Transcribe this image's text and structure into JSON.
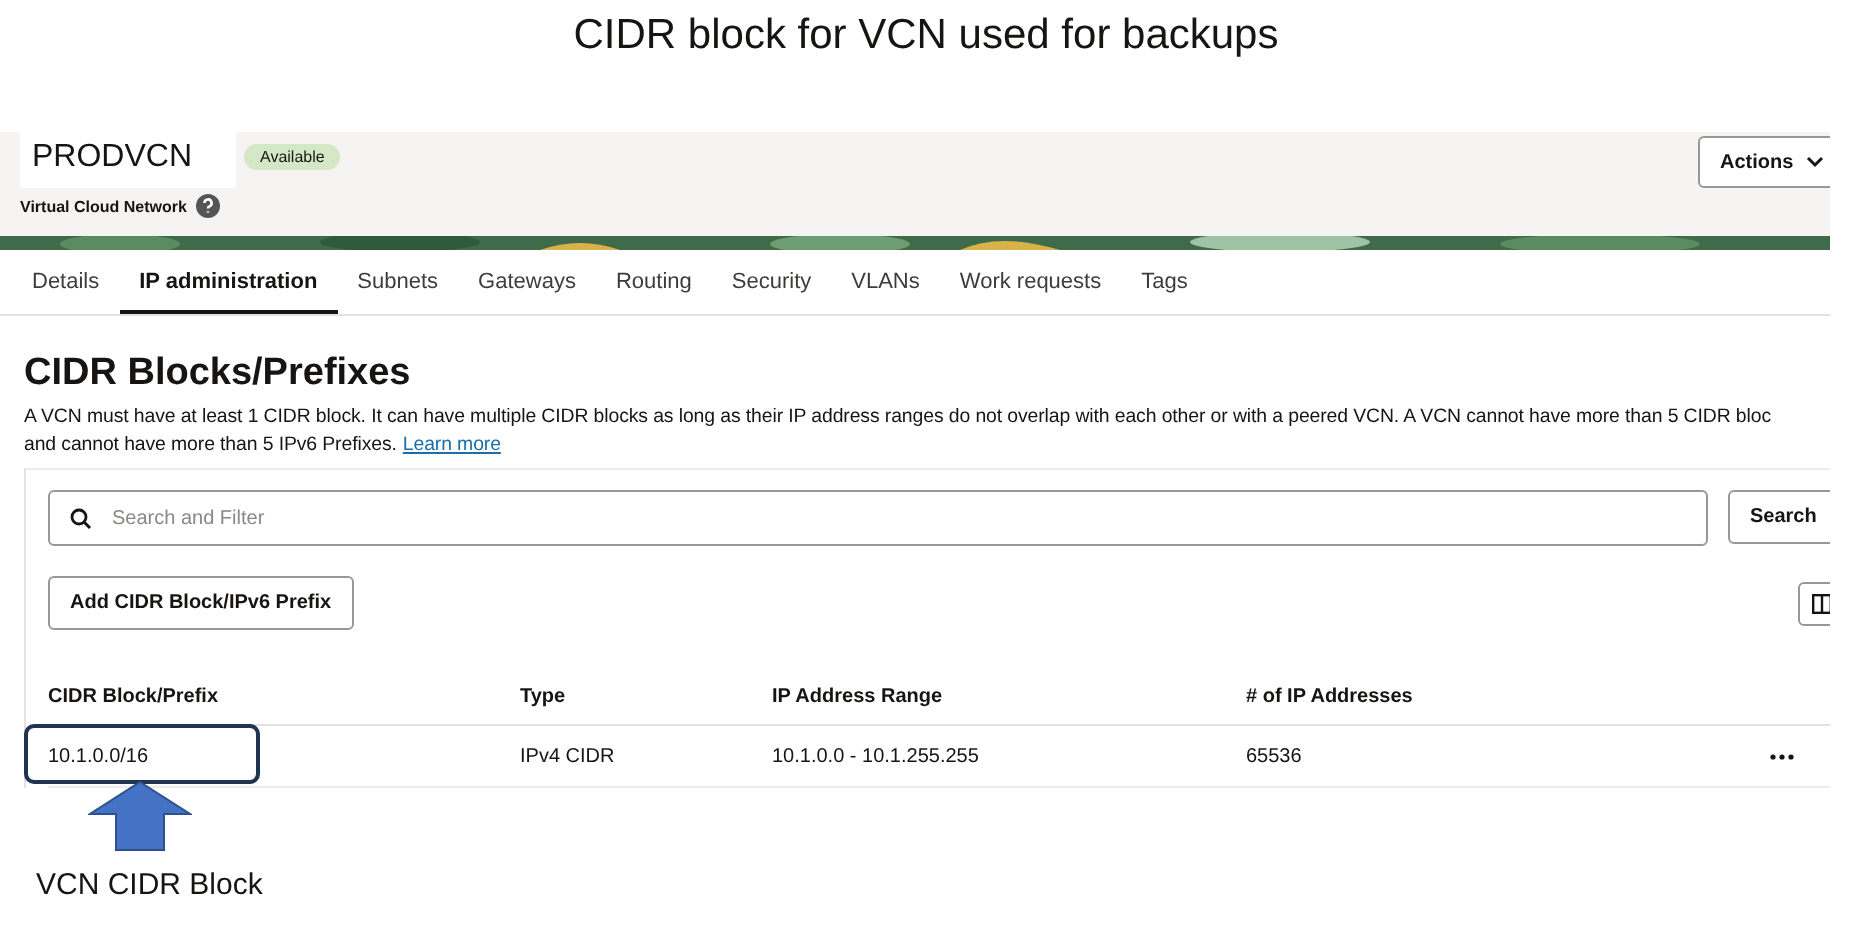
{
  "annotation": {
    "title": "CIDR block for VCN used for backups",
    "caption": "VCN CIDR Block"
  },
  "header": {
    "name": "PRODVCN",
    "status": "Available",
    "subtitle": "Virtual Cloud Network",
    "actions": "Actions"
  },
  "tabs": [
    {
      "label": "Details",
      "selected": false
    },
    {
      "label": "IP administration",
      "selected": true
    },
    {
      "label": "Subnets",
      "selected": false
    },
    {
      "label": "Gateways",
      "selected": false
    },
    {
      "label": "Routing",
      "selected": false
    },
    {
      "label": "Security",
      "selected": false
    },
    {
      "label": "VLANs",
      "selected": false
    },
    {
      "label": "Work requests",
      "selected": false
    },
    {
      "label": "Tags",
      "selected": false
    }
  ],
  "section": {
    "heading": "CIDR Blocks/Prefixes",
    "description_lines": [
      "A VCN must have at least 1 CIDR block. It can have multiple CIDR blocks as long as their IP address ranges do not overlap with each other or with a peered VCN. A VCN cannot have more than 5 CIDR bloc",
      "and cannot have more than 5 IPv6 Prefixes."
    ],
    "link": "Learn more"
  },
  "search": {
    "placeholder": "Search and Filter",
    "button": "Search"
  },
  "add_button": "Add CIDR Block/IPv6 Prefix",
  "table": {
    "columns": [
      "CIDR Block/Prefix",
      "Type",
      "IP Address Range",
      "# of IP Addresses"
    ],
    "rows": [
      {
        "cells": [
          "10.1.0.0/16",
          "IPv4 CIDR",
          "10.1.0.0 - 10.1.255.255",
          "65536"
        ],
        "highlighted": true
      }
    ]
  }
}
